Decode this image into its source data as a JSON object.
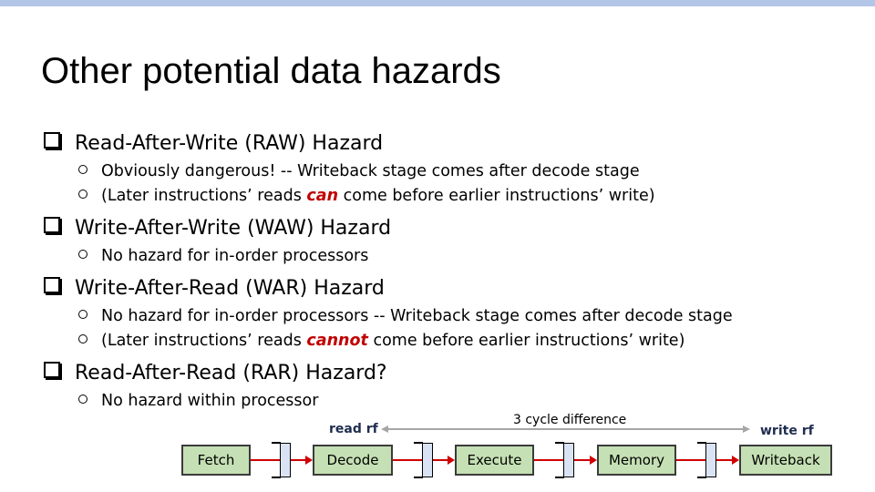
{
  "slide": {
    "title": "Other potential data hazards",
    "accent_bar_color": "#b4c6e7",
    "sections": [
      {
        "heading": "Read-After-Write (RAW) Hazard",
        "bullets": [
          {
            "text": "Obviously dangerous! -- Writeback stage comes after decode stage"
          },
          {
            "pre": "(Later instructions’ reads ",
            "emph": "can",
            "post": " come before earlier instructions’ write)"
          }
        ]
      },
      {
        "heading": "Write-After-Write (WAW) Hazard",
        "bullets": [
          {
            "text": "No hazard for in-order processors"
          }
        ]
      },
      {
        "heading": "Write-After-Read (WAR) Hazard",
        "bullets": [
          {
            "text": "No hazard for in-order processors -- Writeback stage comes after decode stage"
          },
          {
            "pre": "(Later instructions’ reads ",
            "emph": "cannot",
            "post": " come before earlier instructions’ write)"
          }
        ]
      },
      {
        "heading": "Read-After-Read (RAR) Hazard?",
        "bullets": [
          {
            "text": "No hazard within processor"
          }
        ]
      }
    ]
  },
  "pipeline": {
    "stages": [
      "Fetch",
      "Decode",
      "Execute",
      "Memory",
      "Writeback"
    ],
    "read_label": "read rf",
    "write_label": "write rf",
    "cycle_label": "3 cycle difference",
    "colors": {
      "stage_fill": "#c5e0b4",
      "register_fill": "#dae3f3",
      "wire": "#d00000",
      "emphasis": "#c00000"
    }
  }
}
